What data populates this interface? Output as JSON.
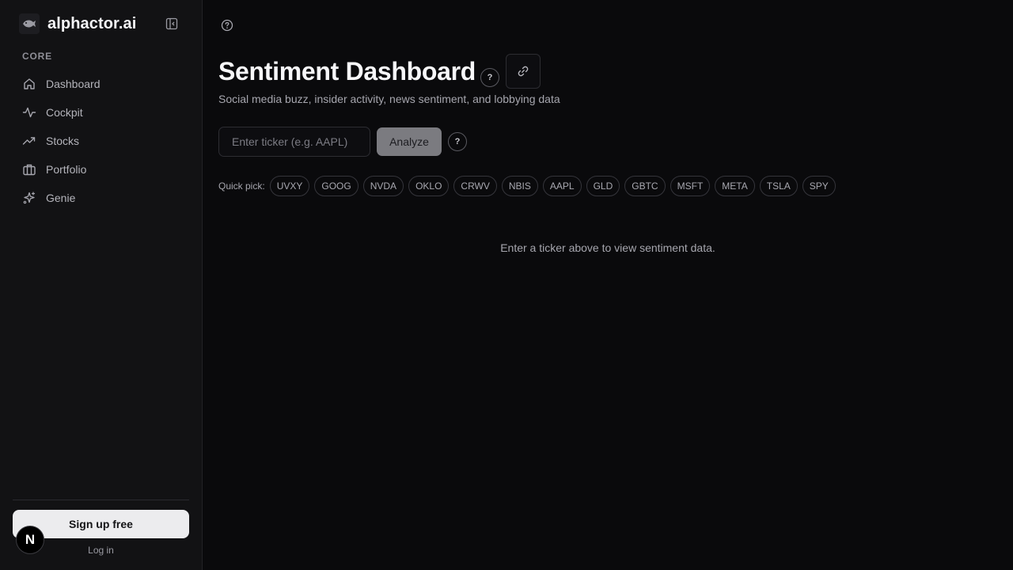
{
  "brand": {
    "name": "alphactor.ai",
    "logo_icon": "fish-logo-icon"
  },
  "sidebar": {
    "section_label": "CORE",
    "items": [
      {
        "label": "Dashboard",
        "icon": "home-icon"
      },
      {
        "label": "Cockpit",
        "icon": "activity-icon"
      },
      {
        "label": "Stocks",
        "icon": "trending-up-icon"
      },
      {
        "label": "Portfolio",
        "icon": "briefcase-icon"
      },
      {
        "label": "Genie",
        "icon": "sparkles-icon"
      }
    ],
    "signup_label": "Sign up free",
    "login_label": "Log in",
    "badge_letter": "N"
  },
  "main": {
    "title": "Sentiment Dashboard",
    "title_help": "?",
    "subtitle": "Social media buzz, insider activity, news sentiment, and lobbying data",
    "search": {
      "placeholder": "Enter ticker (e.g. AAPL)",
      "value": "",
      "analyze_label": "Analyze",
      "help": "?"
    },
    "quick_pick": {
      "label": "Quick pick:",
      "tickers": [
        "UVXY",
        "GOOG",
        "NVDA",
        "OKLO",
        "CRWV",
        "NBIS",
        "AAPL",
        "GLD",
        "GBTC",
        "MSFT",
        "META",
        "TSLA",
        "SPY"
      ]
    },
    "empty_message": "Enter a ticker above to view sentiment data."
  },
  "colors": {
    "background": "#0a0a0c",
    "sidebar_bg": "#121214",
    "signup_bg": "#ececee",
    "analyze_bg": "#7b7b80"
  }
}
